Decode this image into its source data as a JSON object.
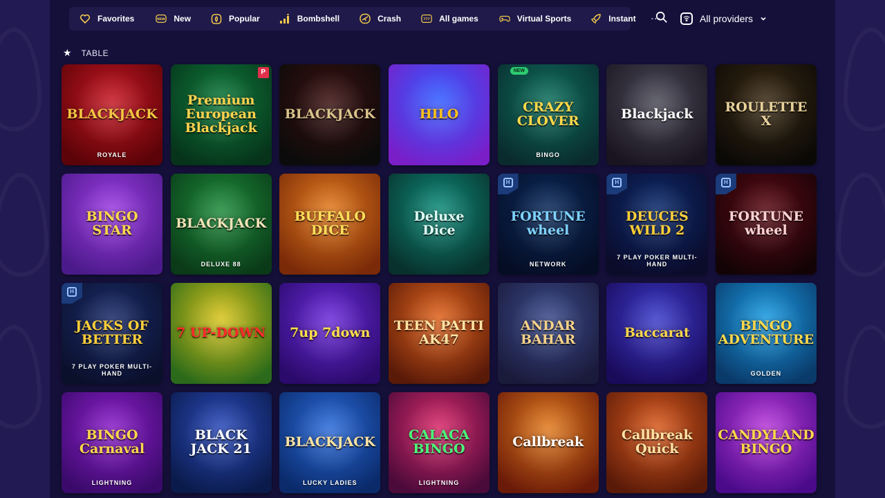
{
  "nav": {
    "items": [
      {
        "label": "Favorites",
        "icon": "heart-icon"
      },
      {
        "label": "New",
        "icon": "new-badge-icon"
      },
      {
        "label": "Popular",
        "icon": "fire-icon"
      },
      {
        "label": "Bombshell",
        "icon": "chart-bars-icon"
      },
      {
        "label": "Crash",
        "icon": "plane-icon"
      },
      {
        "label": "All games",
        "icon": "slot-machine-icon"
      },
      {
        "label": "Virtual Sports",
        "icon": "gamepad-icon"
      },
      {
        "label": "Instant",
        "icon": "rocket-icon"
      }
    ],
    "more": "···"
  },
  "providers": {
    "label": "All providers",
    "icon": "provider-icon"
  },
  "section": {
    "icon": "star-icon",
    "title": "TABLE"
  },
  "games": [
    {
      "title": "BLACKJACK",
      "sub": "ROYALE",
      "bg": [
        "#c41622",
        "#5a0308"
      ],
      "accent": "#f4c542"
    },
    {
      "title": "Premium European\nBlackjack",
      "sub": "",
      "bg": [
        "#0f7a3c",
        "#06331a"
      ],
      "accent": "#ffd34d",
      "tag": "P"
    },
    {
      "title": "BLACKJACK",
      "sub": "",
      "bg": [
        "#3a0f0f",
        "#0b0b0b"
      ],
      "accent": "#d9c38a"
    },
    {
      "title": "HILO",
      "sub": "",
      "bg": [
        "#2f5bff",
        "#7a1ec8"
      ],
      "accent": "#ffc21a"
    },
    {
      "title": "CRAZY\nCLOVER",
      "sub": "BINGO",
      "bg": [
        "#0d6e5c",
        "#0a2b2e"
      ],
      "accent": "#ffd84a",
      "badge": "NEW"
    },
    {
      "title": "Blackjack",
      "sub": "",
      "bg": [
        "#4a4a57",
        "#1a1420"
      ],
      "accent": "#ffffff"
    },
    {
      "title": "ROULETTE X",
      "sub": "",
      "bg": [
        "#3a2a14",
        "#0b0906"
      ],
      "accent": "#e8d29a"
    },
    {
      "title": "BINGO\nSTAR",
      "sub": "",
      "bg": [
        "#9b3be0",
        "#4b1a8a"
      ],
      "accent": "#ffd84a"
    },
    {
      "title": "BLACKJACK",
      "sub": "DELUXE 88",
      "bg": [
        "#1d8a3a",
        "#0a3a18"
      ],
      "accent": "#f0e2b6"
    },
    {
      "title": "BUFFALO\nDICE",
      "sub": "",
      "bg": [
        "#e07a1e",
        "#7a2a08"
      ],
      "accent": "#ffdf5a"
    },
    {
      "title": "Deluxe\nDice",
      "sub": "",
      "bg": [
        "#0e8a78",
        "#08302c"
      ],
      "accent": "#dffcf4"
    },
    {
      "title": "FORTUNE\nwheel",
      "sub": "NETWORK",
      "bg": [
        "#0b2a5a",
        "#050d24"
      ],
      "accent": "#7fd3ff",
      "corner": true
    },
    {
      "title": "DEUCES\nWILD 2",
      "sub": "7 PLAY POKER MULTI-HAND",
      "bg": [
        "#0b2a6a",
        "#0b0b2a"
      ],
      "accent": "#ffcf3a",
      "corner": true
    },
    {
      "title": "FORTUNE\nwheel",
      "sub": "",
      "bg": [
        "#5a0a14",
        "#140306"
      ],
      "accent": "#ffd3d3",
      "corner": true
    },
    {
      "title": "JACKS OF\nBETTER",
      "sub": "7 PLAY POKER MULTI-HAND",
      "bg": [
        "#1a2c6a",
        "#0a0f2a"
      ],
      "accent": "#ffcf3a",
      "corner": true
    },
    {
      "title": "7 UP-DOWN",
      "sub": "",
      "bg": [
        "#d8c21a",
        "#2a6a1a"
      ],
      "accent": "#ff2a2a"
    },
    {
      "title": "7up 7down",
      "sub": "",
      "bg": [
        "#6a2ad8",
        "#2a0a6a"
      ],
      "accent": "#ffe04a"
    },
    {
      "title": "TEEN PATTI\nAK47",
      "sub": "",
      "bg": [
        "#e0641e",
        "#5a1a08"
      ],
      "accent": "#ffe3a3"
    },
    {
      "title": "ANDAR BAHAR",
      "sub": "",
      "bg": [
        "#3a4a8a",
        "#1a1a3a"
      ],
      "accent": "#f6d28a"
    },
    {
      "title": "Baccarat",
      "sub": "",
      "bg": [
        "#3a3ac8",
        "#1a0a5a"
      ],
      "accent": "#ffd84a"
    },
    {
      "title": "BINGO\nADVENTURE",
      "sub": "GOLDEN",
      "bg": [
        "#1a9ae0",
        "#0a3a6a"
      ],
      "accent": "#ffd84a"
    },
    {
      "title": "BINGO\nCarnaval",
      "sub": "LIGHTNING",
      "bg": [
        "#8a1ec8",
        "#3a0a6a"
      ],
      "accent": "#ffd84a"
    },
    {
      "title": "BLACK\nJACK 21",
      "sub": "",
      "bg": [
        "#2a4ab8",
        "#0a1a4a"
      ],
      "accent": "#ffffff"
    },
    {
      "title": "BLACKJACK",
      "sub": "LUCKY LADIES",
      "bg": [
        "#2a6ad8",
        "#0a2a6a"
      ],
      "accent": "#ffe3a3"
    },
    {
      "title": "CALACA\nBINGO",
      "sub": "LIGHTNING",
      "bg": [
        "#d82a6a",
        "#4a0a3a"
      ],
      "accent": "#4aff7a"
    },
    {
      "title": "Callbreak",
      "sub": "",
      "bg": [
        "#e07a1e",
        "#6a1a08"
      ],
      "accent": "#ffffff"
    },
    {
      "title": "Callbreak\nQuick",
      "sub": "",
      "bg": [
        "#d85a1e",
        "#5a1a08"
      ],
      "accent": "#ffe3a3"
    },
    {
      "title": "CANDYLAND\nBINGO",
      "sub": "",
      "bg": [
        "#b83ad8",
        "#4a0a8a"
      ],
      "accent": "#ffd84a"
    }
  ]
}
